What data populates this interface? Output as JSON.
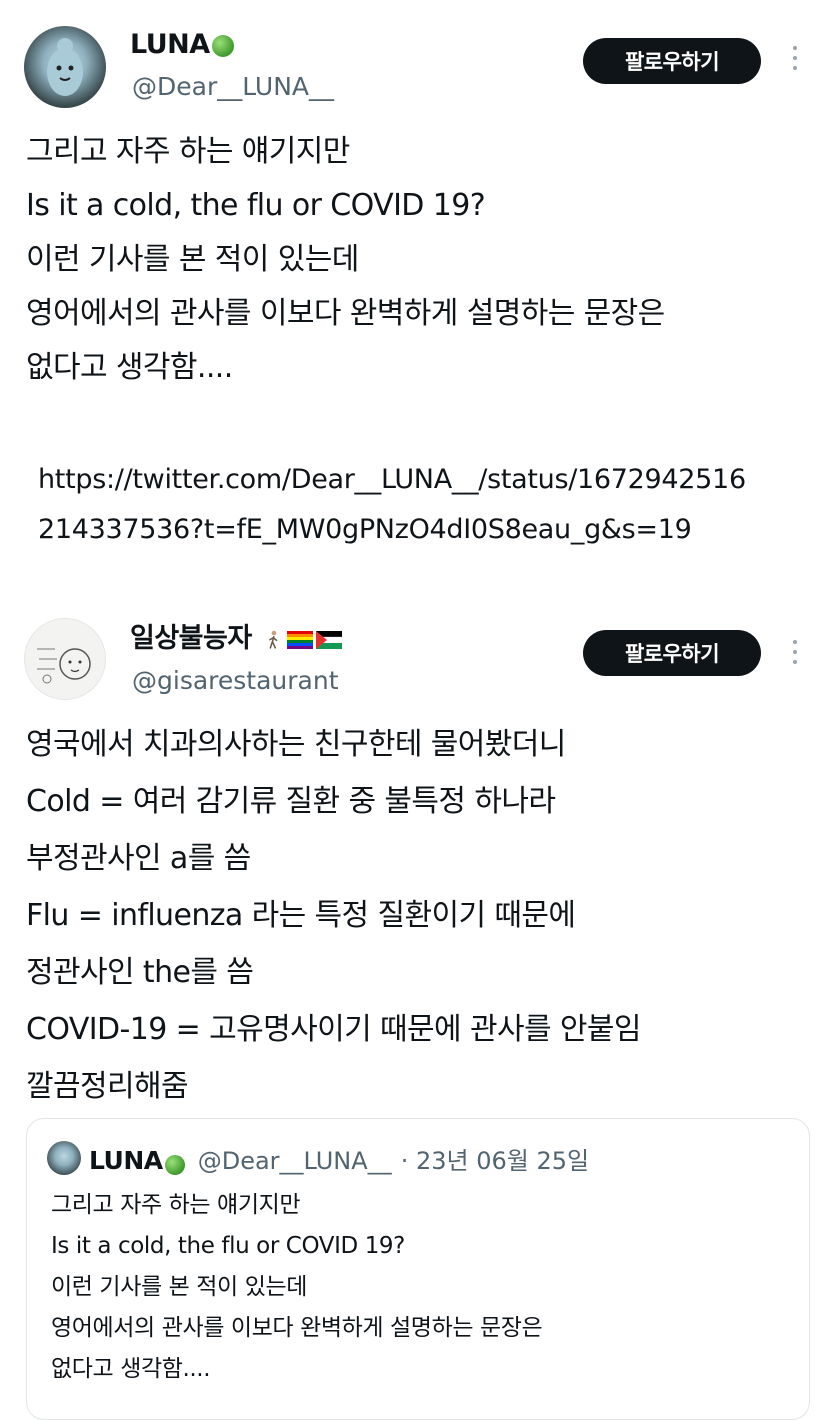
{
  "tweet1": {
    "name": "LUNA",
    "handle": "@Dear__LUNA__",
    "follow_label": "팔로우하기",
    "lines": [
      "그리고 자주 하는 얘기지만",
      "Is it a cold, the flu or COVID 19?",
      "이런 기사를 본 적이 있는데",
      "영어에서의 관사를 이보다 완벽하게 설명하는 문장은",
      "없다고 생각함...."
    ]
  },
  "link": {
    "lines": [
      "https://twitter.com/Dear__LUNA__/status/1672942516",
      "214337536?t=fE_MW0gPNzO4dI0S8eau_g&s=19"
    ]
  },
  "tweet2": {
    "name": "일상불능자",
    "handle": "@gisarestaurant",
    "follow_label": "팔로우하기",
    "lines": [
      "영국에서 치과의사하는 친구한테 물어봤더니",
      "Cold = 여러 감기류 질환 중 불특정 하나라",
      "부정관사인 a를 씀",
      "Flu = influenza 라는 특정 질환이기 때문에",
      "정관사인 the를 씀",
      "COVID-19 = 고유명사이기 때문에 관사를 안붙임",
      "깔끔정리해줌"
    ]
  },
  "quote": {
    "name": "LUNA",
    "handle": "@Dear__LUNA__",
    "date": "· 23년 06월 25일",
    "lines": [
      "그리고 자주 하는 얘기지만",
      "Is it a cold, the flu or COVID 19?",
      "이런 기사를 본 적이 있는데",
      "영어에서의 관사를 이보다 완벽하게 설명하는 문장은",
      "없다고 생각함...."
    ]
  },
  "icons": {
    "more": "more-options-icon",
    "verified_leaf": "leaf-badge-icon",
    "flags": [
      "walking-person-icon",
      "rainbow-flag-icon",
      "palestine-flag-icon"
    ]
  },
  "colors": {
    "text": "#0f1419",
    "secondary": "#536471",
    "button": "#0f1419",
    "leaf": "#3f9a2c"
  }
}
